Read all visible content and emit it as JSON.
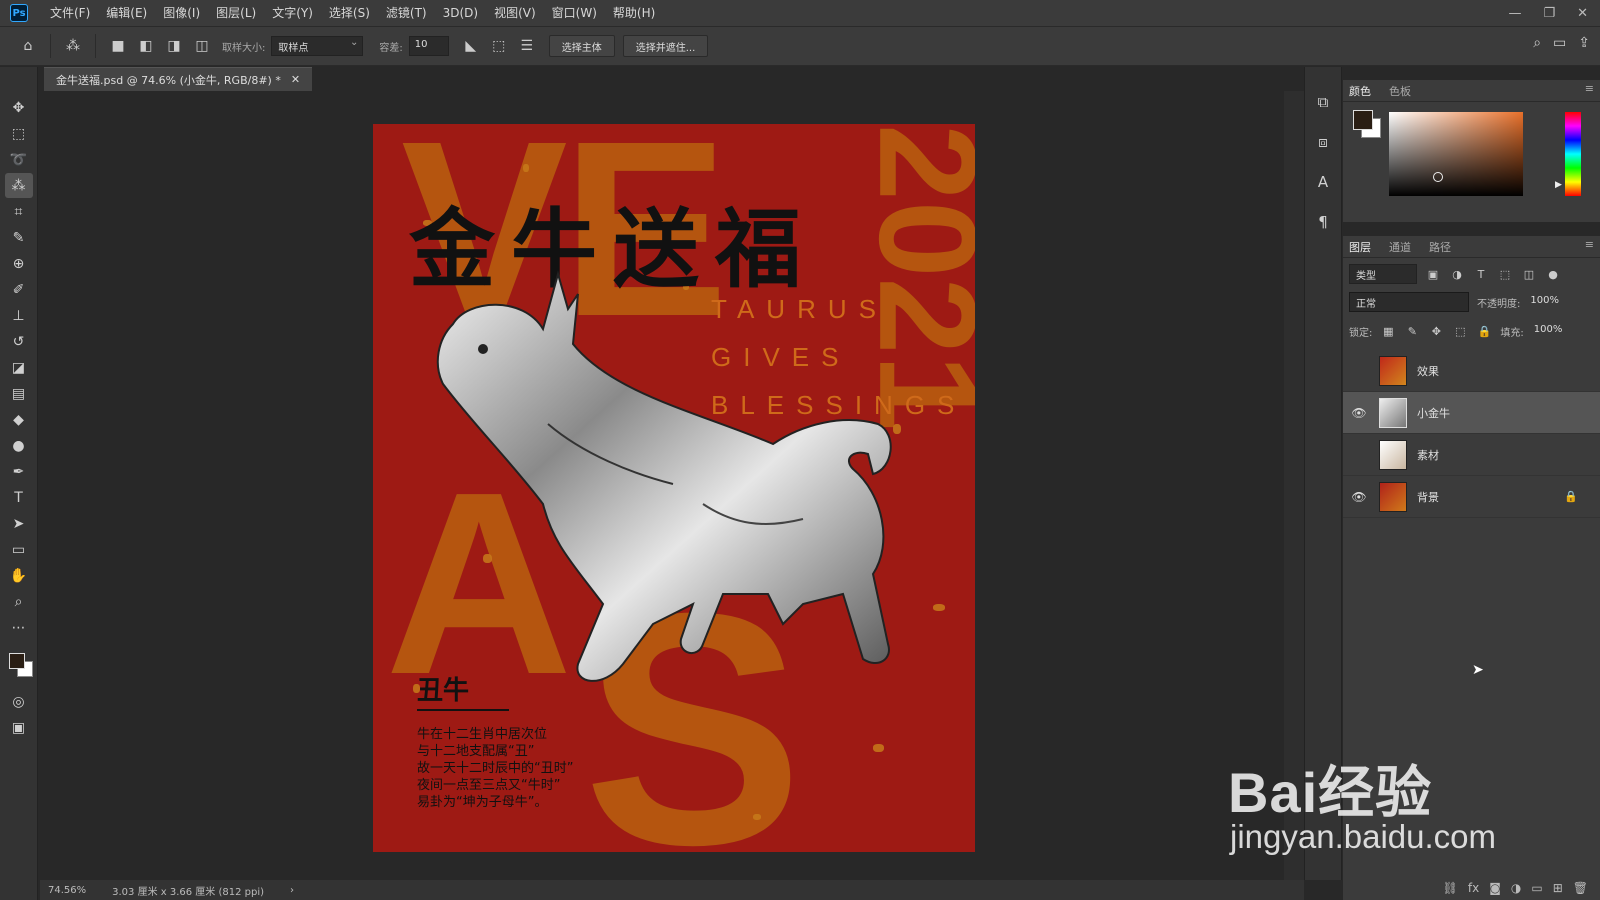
{
  "app": {
    "logo": "Ps"
  },
  "menu": [
    "文件(F)",
    "编辑(E)",
    "图像(I)",
    "图层(L)",
    "文字(Y)",
    "选择(S)",
    "滤镜(T)",
    "3D(D)",
    "视图(V)",
    "窗口(W)",
    "帮助(H)"
  ],
  "window_controls": {
    "minimize": "—",
    "restore": "❐",
    "close": "✕"
  },
  "options": {
    "sample_size_label": "取样大小:",
    "sample_size_value": "取样点",
    "tolerance_label": "容差:",
    "tolerance_value": "10",
    "select_subject": "选择主体",
    "select_mask": "选择并遮住..."
  },
  "document": {
    "tab_title": "金牛送福.psd @ 74.6% (小金牛, RGB/8#) *",
    "zoom": "74.56%",
    "size_info": "3.03 厘米 x 3.66 厘米 (812 ppi)"
  },
  "poster": {
    "title": "金牛送福",
    "english_1": "TAURUS",
    "english_2": "GIVES",
    "english_3": "BLESSINGS",
    "year": "2021",
    "bg_letters": [
      "VE",
      "A",
      "S"
    ],
    "subtitle": "丑牛",
    "body": [
      "牛在十二生肖中居次位",
      "与十二地支配属“丑”",
      "故一天十二时辰中的“丑时”",
      "夜间一点至三点又“牛时”",
      "易卦为“坤为子母牛”。"
    ]
  },
  "color_panel": {
    "tabs": [
      "颜色",
      "色板"
    ],
    "fg_color": "#2a1e14",
    "bg_color": "#ffffff"
  },
  "layers_panel": {
    "tabs": [
      "图层",
      "通道",
      "路径"
    ],
    "kind_filter": "类型",
    "blend_mode": "正常",
    "opacity_label": "不透明度:",
    "opacity_value": "100%",
    "lock_label": "锁定:",
    "fill_label": "填充:",
    "fill_value": "100%",
    "layers": [
      {
        "name": "效果",
        "visible": false,
        "selected": false,
        "locked": false
      },
      {
        "name": "小金牛",
        "visible": true,
        "selected": true,
        "locked": false
      },
      {
        "name": "素材",
        "visible": false,
        "selected": false,
        "locked": false
      },
      {
        "name": "背景",
        "visible": true,
        "selected": false,
        "locked": true
      }
    ]
  },
  "watermark": {
    "brand": "Bai经验",
    "url": "jingyan.baidu.com"
  }
}
